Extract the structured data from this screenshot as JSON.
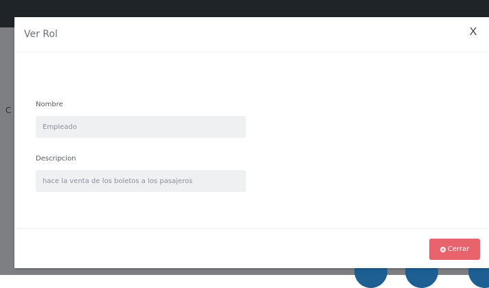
{
  "modal": {
    "title": "Ver Rol",
    "close_label": "X",
    "fields": {
      "nombre": {
        "label": "Nombre",
        "value": "Empleado"
      },
      "descripcion": {
        "label": "Descripcion",
        "value": "hace la venta de los boletos a los pasajeros"
      }
    },
    "footer": {
      "close_button_label": "Cerrar",
      "close_button_icon": "x-circle-icon",
      "close_button_color": "#e9636d"
    }
  },
  "background": {
    "topbar_color": "#1f2428",
    "overlay_color": "#7d7f82",
    "partial_letter": "C"
  }
}
